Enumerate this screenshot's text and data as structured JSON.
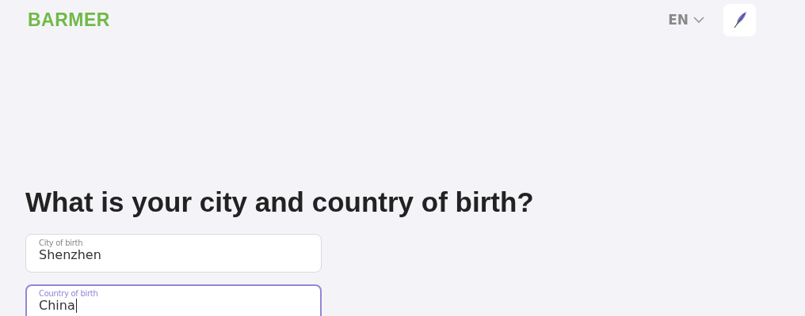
{
  "header": {
    "logo": "BARMER",
    "language": "EN"
  },
  "heading": "What is your city and country of birth?",
  "fields": [
    {
      "label": "City of birth",
      "value": "Shenzhen",
      "focused": false
    },
    {
      "label": "Country of birth",
      "value": "China",
      "focused": true
    }
  ]
}
